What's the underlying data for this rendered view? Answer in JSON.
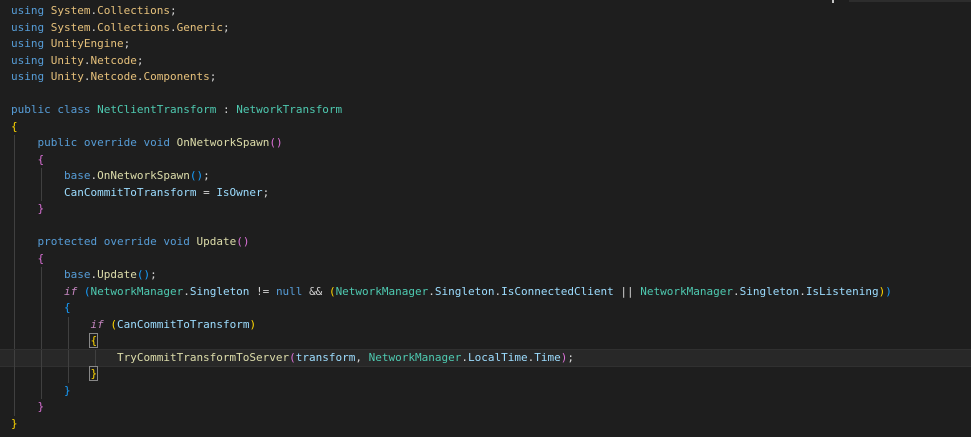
{
  "editor": {
    "language": "csharp",
    "theme_colors": {
      "background": "#1e1e1e",
      "keyword": "#569cd6",
      "control_keyword": "#c586c0",
      "type": "#4ec9b0",
      "function": "#dcdcaa",
      "namespace": "#e5c07b",
      "bracket_level1": "#ffd700",
      "bracket_level2": "#da70d6",
      "bracket_level3": "#179fff"
    },
    "current_line": 22
  },
  "code": {
    "l1": {
      "kw": "using",
      "a": "System",
      "b": "Collections"
    },
    "l2": {
      "kw": "using",
      "a": "System",
      "b": "Collections",
      "c": "Generic"
    },
    "l3": {
      "kw": "using",
      "a": "UnityEngine"
    },
    "l4": {
      "kw": "using",
      "a": "Unity",
      "b": "Netcode"
    },
    "l5": {
      "kw": "using",
      "a": "Unity",
      "b": "Netcode",
      "c": "Components"
    },
    "l7": {
      "k1": "public",
      "k2": "class",
      "name": "NetClientTransform",
      "sep": ":",
      "base": "NetworkTransform"
    },
    "l9": {
      "k1": "public",
      "k2": "override",
      "k3": "void",
      "fn": "OnNetworkSpawn"
    },
    "l11": {
      "k1": "base",
      "fn": "OnNetworkSpawn"
    },
    "l12": {
      "lhs": "CanCommitToTransform",
      "op": "=",
      "rhs": "IsOwner"
    },
    "l15": {
      "k1": "protected",
      "k2": "override",
      "k3": "void",
      "fn": "Update"
    },
    "l17": {
      "k1": "base",
      "fn": "Update"
    },
    "l18": {
      "k1": "if",
      "t1": "NetworkManager",
      "p1": "Singleton",
      "op1": "!=",
      "nul": "null",
      "op2": "&&",
      "t2": "NetworkManager",
      "p2": "Singleton",
      "p3": "IsConnectedClient",
      "op3": "||",
      "t3": "NetworkManager",
      "p4": "Singleton",
      "p5": "IsListening"
    },
    "l20": {
      "k1": "if",
      "cond": "CanCommitToTransform"
    },
    "l22": {
      "fn": "TryCommitTransformToServer",
      "a1": "transform",
      "t1": "NetworkManager",
      "p1": "LocalTime",
      "p2": "Time"
    }
  }
}
